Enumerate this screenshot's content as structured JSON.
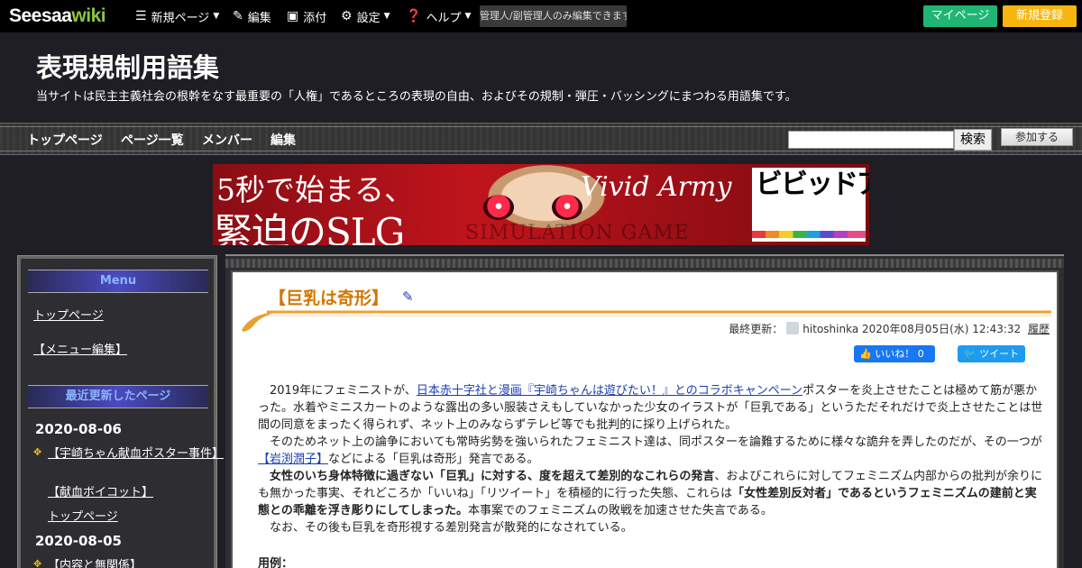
{
  "topbar": {
    "logo_main": "Seesaa",
    "logo_accent": "wiki",
    "new_page": "新規ページ",
    "edit": "編集",
    "attach": "添付",
    "settings": "設定",
    "help": "ヘルプ",
    "notice": "管理人/副管理人のみ編集できます",
    "mypage": "マイページ",
    "signup": "新規登録"
  },
  "header": {
    "title": "表現規制用語集",
    "description": "当サイトは民主主義社会の根幹をなす最重要の「人権」であるところの表現の自由、およびその規制・弾圧・バッシングにまつわる用語集です。"
  },
  "nav": {
    "items": [
      "トップページ",
      "ページ一覧",
      "メンバー",
      "編集"
    ],
    "search_button": "検索",
    "join_button": "参加する"
  },
  "banner": {
    "line1": "5秒で始まる、",
    "line2": "緊迫のSLG",
    "sub": "SIMULATION GAME",
    "script": "Vivid Army",
    "logo_text": "ビビッドアーミー"
  },
  "sidebar": {
    "menu_heading": "Menu",
    "menu_links": [
      "トップページ",
      "【メニュー編集】"
    ],
    "recent_heading": "最近更新したページ",
    "dates": [
      "2020-08-06",
      "2020-08-05"
    ],
    "recent_links_1": [
      "【宇崎ちゃん献血ポスター事件】",
      "【献血ボイコット】",
      "トップページ"
    ],
    "recent_links_2": [
      "【内容と無関係】"
    ]
  },
  "page": {
    "title": "【巨乳は奇形】",
    "meta_label": "最終更新：",
    "author": "hitoshinka",
    "updated": "2020年08月05日(水) 12:43:32",
    "history": "履歴",
    "like": "いいね！ 0",
    "tweet": "ツイート",
    "p1_a": "2019年にフェミニストが、",
    "p1_link": "日本赤十字社と漫画『宇崎ちゃんは遊びたい！』とのコラボキャンペーン",
    "p1_b": "ポスターを炎上させたことは極めて筋が悪かった。水着やミニスカートのような露出の多い服装さえもしていなかった少女のイラストが「巨乳である」というただそれだけで炎上させたことは世間の同意をまったく得られず、ネット上のみならずテレビ等でも批判的に採り上げられた。",
    "p2_a": "そのためネット上の論争においても常時劣勢を強いられたフェミニスト達は、同ポスターを論難するために様々な詭弁を弄したのだが、その一つが",
    "p2_link": "【岩渕潤子】",
    "p2_b": "などによる「巨乳は奇形」発言である。",
    "p3_bold1": "女性のいち身体特徴に過ぎない「巨乳」に対する、度を超えて差別的なこれらの発言",
    "p3_a": "、およびこれらに対してフェミニズム内部からの批判が余りにも無かった事実、それどころか「いいね」「リツイート」を積極的に行った失態、これらは",
    "p3_bold2": "「女性差別反対者」であるというフェミニズムの建前と実態との乖離を浮き彫りにしてしまった。",
    "p3_b": "本事案でのフェミニズムの敗戦を加速させた失言である。",
    "p4": "なお、その後も巨乳を奇形視する差別発言が散発的になされている。",
    "example_label": "用例："
  }
}
